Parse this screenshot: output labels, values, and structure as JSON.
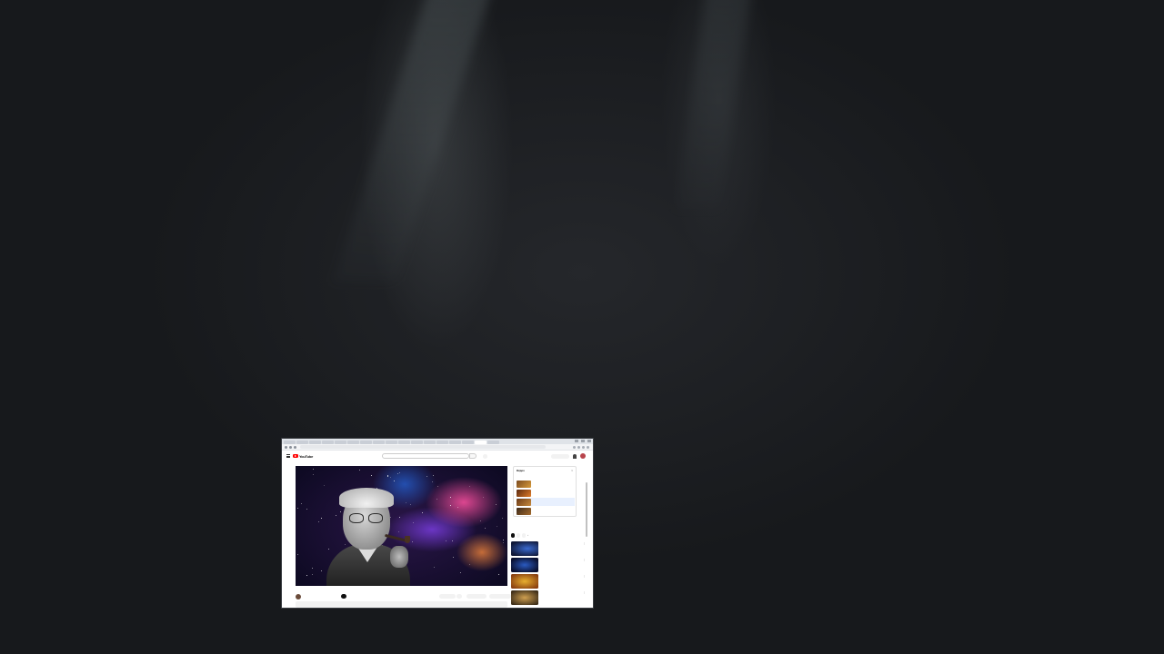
{
  "browser": {
    "tabs": [
      "",
      "",
      "",
      "",
      "",
      "",
      "",
      "",
      "",
      "",
      "",
      "",
      "",
      "",
      "",
      "",
      ""
    ],
    "url": ""
  },
  "youtube": {
    "logo_text": "YouTube",
    "region": "",
    "search_placeholder": "",
    "create_label": "",
    "video": {
      "title": "",
      "channel_name": "",
      "channel_subs": "",
      "subscribe_label": "",
      "actions": [
        "",
        "",
        "",
        "",
        ""
      ],
      "description": ""
    },
    "live_chat": {
      "title": "Видео",
      "subtitle": "",
      "more_label": "",
      "items": [
        "",
        "",
        "",
        ""
      ]
    },
    "chips": [
      "",
      "",
      ""
    ],
    "recommendations": [
      {
        "title": "",
        "meta": ""
      },
      {
        "title": "",
        "meta": ""
      },
      {
        "title": "",
        "meta": ""
      },
      {
        "title": "",
        "meta": ""
      }
    ]
  },
  "colors": {
    "brand_red": "#ff0000",
    "desk_bg": "#16181b"
  }
}
